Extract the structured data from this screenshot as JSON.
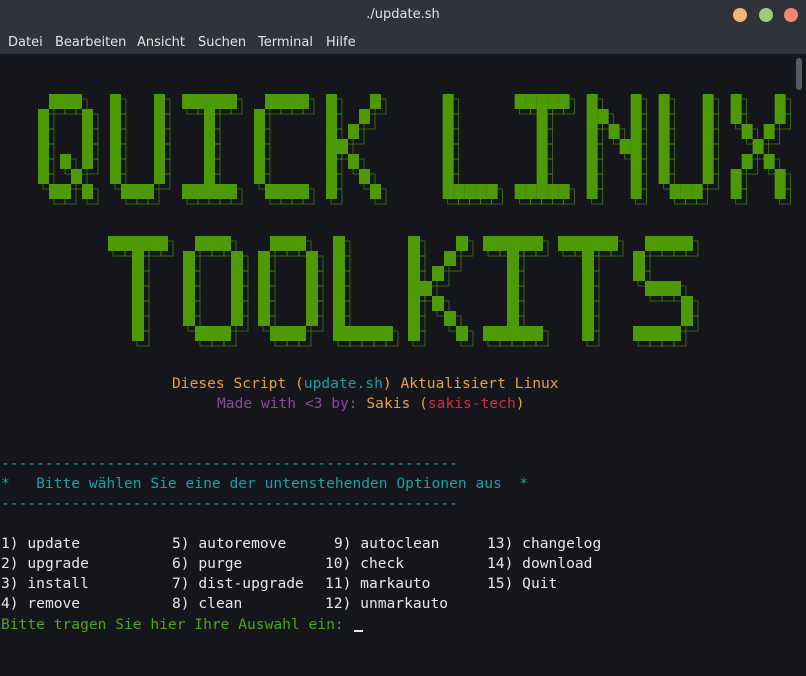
{
  "window": {
    "title": "./update.sh"
  },
  "menubar": {
    "items": [
      "Datei",
      "Bearbeiten",
      "Ansicht",
      "Suchen",
      "Terminal",
      "Hilfe"
    ]
  },
  "banner": {
    "line1": "QUICK LINUX",
    "line2": "TOOLKITS",
    "color": "#4e9a06"
  },
  "info": {
    "script_prefix": "Dieses Script (",
    "script_name": "update.sh",
    "script_suffix": ") Aktualisiert Linux",
    "made_with": "Made with <3 by: ",
    "author": "Sakis",
    "paren_open": " (",
    "handle": "sakis-tech",
    "paren_close": ")"
  },
  "menu": {
    "separator": "----------------------------------------------------",
    "prompt_title": "*   Bitte wählen Sie eine der untenstehenden Optionen aus  *",
    "options": [
      {
        "num": "1)",
        "label": "update"
      },
      {
        "num": "2)",
        "label": "upgrade"
      },
      {
        "num": "3)",
        "label": "install"
      },
      {
        "num": "4)",
        "label": "remove"
      },
      {
        "num": "5)",
        "label": "autoremove"
      },
      {
        "num": "6)",
        "label": "purge"
      },
      {
        "num": "7)",
        "label": "dist-upgrade"
      },
      {
        "num": "8)",
        "label": "clean"
      },
      {
        "num": "9)",
        "label": "autoclean"
      },
      {
        "num": "10)",
        "label": "check"
      },
      {
        "num": "11)",
        "label": "markauto"
      },
      {
        "num": "12)",
        "label": "unmarkauto"
      },
      {
        "num": "13)",
        "label": "changelog"
      },
      {
        "num": "14)",
        "label": "download"
      },
      {
        "num": "15)",
        "label": "Quit"
      }
    ]
  },
  "input": {
    "prompt": "Bitte tragen Sie hier Ihre Auswahl ein: ",
    "value": ""
  }
}
